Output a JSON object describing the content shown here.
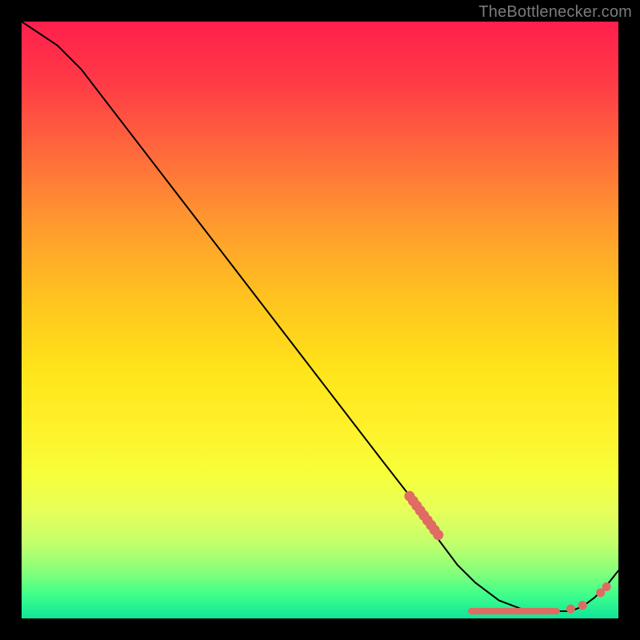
{
  "attribution": "TheBottlenecker.com",
  "colors": {
    "page_bg": "#000000",
    "attribution_text": "#7b7b7b",
    "curve": "#000000",
    "dots": "#e06b63",
    "gradient_top": "#ff1f4c",
    "gradient_bottom": "#10e59a"
  },
  "chart_data": {
    "type": "line",
    "title": "",
    "xlabel": "",
    "ylabel": "",
    "xlim": [
      0,
      100
    ],
    "ylim": [
      0,
      100
    ],
    "grid": false,
    "series": [
      {
        "name": "curve",
        "x": [
          0,
          6,
          10,
          20,
          30,
          40,
          50,
          60,
          67,
          70,
          73,
          76,
          80,
          84,
          88,
          90,
          92,
          94,
          96,
          98,
          100
        ],
        "values": [
          100,
          96,
          92,
          79,
          66,
          53,
          40,
          27,
          18,
          13,
          9,
          6,
          3,
          1.5,
          1.2,
          1.2,
          1.2,
          2.0,
          3.5,
          5.5,
          8.0
        ]
      }
    ],
    "markers": {
      "cluster_diagonal": {
        "x_range": [
          65.0,
          69.8
        ],
        "y_range": [
          20.5,
          14.0
        ],
        "count": 9
      },
      "cluster_bottom": {
        "x_range": [
          75.5,
          89.5
        ],
        "y_fixed": 1.2,
        "count": 22
      },
      "cluster_tail": {
        "points": [
          {
            "x": 92.0,
            "y": 1.6
          },
          {
            "x": 94.0,
            "y": 2.2
          },
          {
            "x": 97.0,
            "y": 4.3
          },
          {
            "x": 98.0,
            "y": 5.3
          }
        ]
      }
    }
  }
}
